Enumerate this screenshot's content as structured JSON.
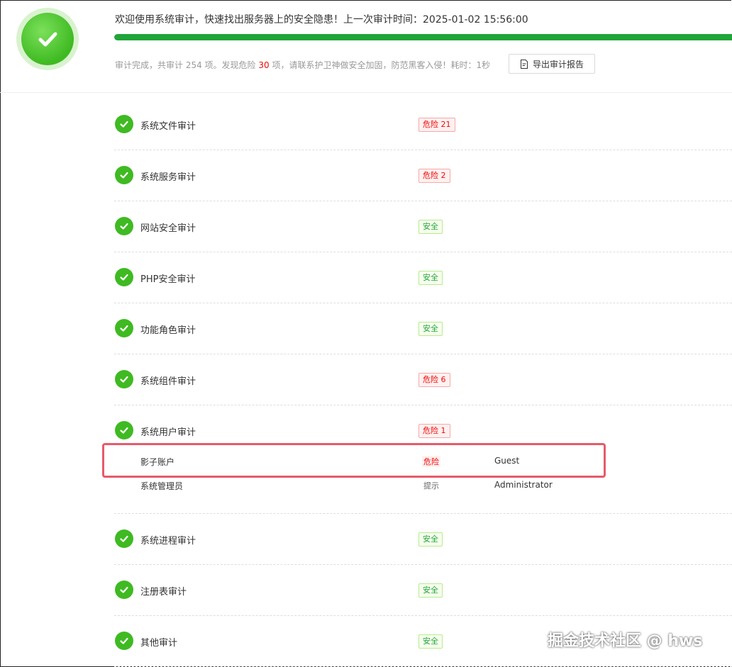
{
  "header": {
    "welcome": "欢迎使用系统审计，快速找出服务器上的安全隐患！上一次审计时间：2025-01-02 15:56:00",
    "progress_percent": 100,
    "summary_prefix": "审计完成，共审计 254 项。发现危险 ",
    "danger_count": "30",
    "summary_suffix": " 项，请联系护卫神做安全加固，防范黑客入侵！耗时：1秒",
    "export_label": "导出审计报告"
  },
  "items": [
    {
      "label": "系统文件审计",
      "status": "危险 21",
      "type": "danger"
    },
    {
      "label": "系统服务审计",
      "status": "危险 2",
      "type": "danger"
    },
    {
      "label": "网站安全审计",
      "status": "安全",
      "type": "safe"
    },
    {
      "label": "PHP安全审计",
      "status": "安全",
      "type": "safe"
    },
    {
      "label": "功能角色审计",
      "status": "安全",
      "type": "safe"
    },
    {
      "label": "系统组件审计",
      "status": "危险 6",
      "type": "danger"
    },
    {
      "label": "系统用户审计",
      "status": "危险 1",
      "type": "danger"
    },
    {
      "label": "系统进程审计",
      "status": "安全",
      "type": "safe"
    },
    {
      "label": "注册表审计",
      "status": "安全",
      "type": "safe"
    },
    {
      "label": "其他审计",
      "status": "安全",
      "type": "safe"
    }
  ],
  "user_details": [
    {
      "name": "影子账户",
      "tag": "危险",
      "value": "Guest"
    },
    {
      "name": "系统管理员",
      "tag": "提示",
      "value": "Administrator"
    }
  ],
  "watermark": "掘金技术社区 @ hws",
  "colors": {
    "accent": "#20a53a",
    "danger": "#ef0808",
    "highlight": "#e85a6a"
  }
}
